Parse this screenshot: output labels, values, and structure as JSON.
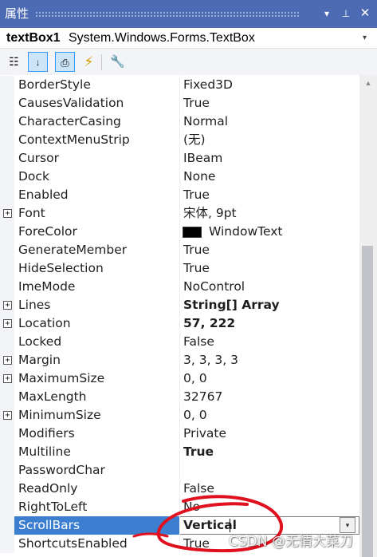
{
  "titlebar": {
    "title": "属性",
    "dropdown_icon": "▾",
    "pin_icon": "⊥",
    "close_icon": "✕"
  },
  "object_selector": {
    "name": "textBox1",
    "type": "System.Windows.Forms.TextBox",
    "arrow": "▾"
  },
  "toolbar": {
    "categorized_icon": "☷",
    "alphabetical_icon": "↓",
    "properties_icon": "⎙",
    "events_icon": "⚡",
    "property_pages_icon": "🔧"
  },
  "properties": [
    {
      "name": "BorderStyle",
      "value": "Fixed3D"
    },
    {
      "name": "CausesValidation",
      "value": "True"
    },
    {
      "name": "CharacterCasing",
      "value": "Normal"
    },
    {
      "name": "ContextMenuStrip",
      "value": "(无)"
    },
    {
      "name": "Cursor",
      "value": "IBeam"
    },
    {
      "name": "Dock",
      "value": "None"
    },
    {
      "name": "Enabled",
      "value": "True"
    },
    {
      "name": "Font",
      "value": "宋体, 9pt",
      "expandable": true
    },
    {
      "name": "ForeColor",
      "value": "WindowText",
      "swatch": "#000000"
    },
    {
      "name": "GenerateMember",
      "value": "True"
    },
    {
      "name": "HideSelection",
      "value": "True"
    },
    {
      "name": "ImeMode",
      "value": "NoControl"
    },
    {
      "name": "Lines",
      "value": "String[] Array",
      "expandable": true,
      "bold": true
    },
    {
      "name": "Location",
      "value": "57, 222",
      "expandable": true,
      "bold": true
    },
    {
      "name": "Locked",
      "value": "False"
    },
    {
      "name": "Margin",
      "value": "3, 3, 3, 3",
      "expandable": true
    },
    {
      "name": "MaximumSize",
      "value": "0, 0",
      "expandable": true
    },
    {
      "name": "MaxLength",
      "value": "32767"
    },
    {
      "name": "MinimumSize",
      "value": "0, 0",
      "expandable": true
    },
    {
      "name": "Modifiers",
      "value": "Private"
    },
    {
      "name": "Multiline",
      "value": "True",
      "bold": true
    },
    {
      "name": "PasswordChar",
      "value": ""
    },
    {
      "name": "ReadOnly",
      "value": "False"
    },
    {
      "name": "RightToLeft",
      "value": "No"
    },
    {
      "name": "ScrollBars",
      "value": "Vertical",
      "bold": true,
      "selected": true
    },
    {
      "name": "ShortcutsEnabled",
      "value": "True"
    }
  ],
  "expander_glyph": "+",
  "dropdown_glyph": "▾",
  "scroll_up_glyph": "▲",
  "colors": {
    "titlebar": "#4d6bb5",
    "selection": "#3c7fd1",
    "annotation": "#e0101e"
  },
  "watermark": "CSDN @无情大菜刀"
}
